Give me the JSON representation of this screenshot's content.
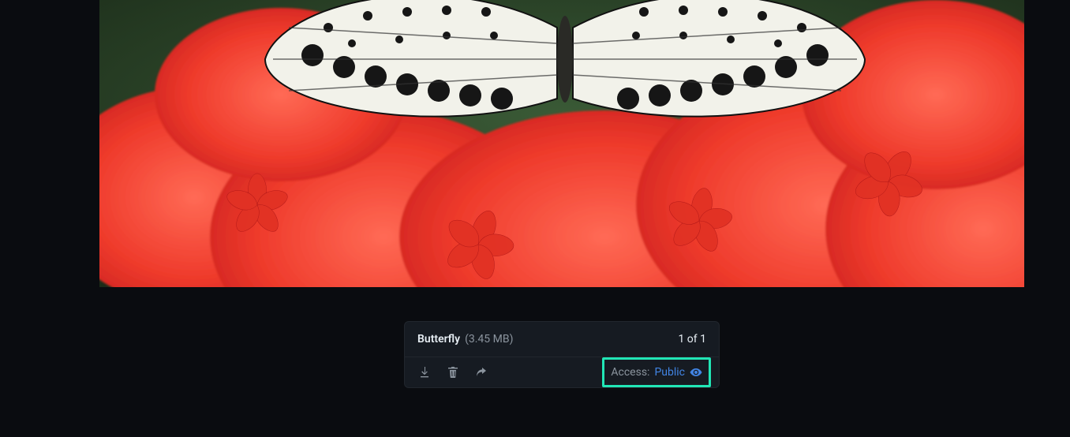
{
  "file": {
    "title": "Butterfly",
    "size": "(3.45 MB)",
    "position": "1 of 1"
  },
  "actions": {
    "download": "Download",
    "delete": "Delete",
    "share": "Share"
  },
  "access": {
    "label": "Access:",
    "value": "Public"
  }
}
